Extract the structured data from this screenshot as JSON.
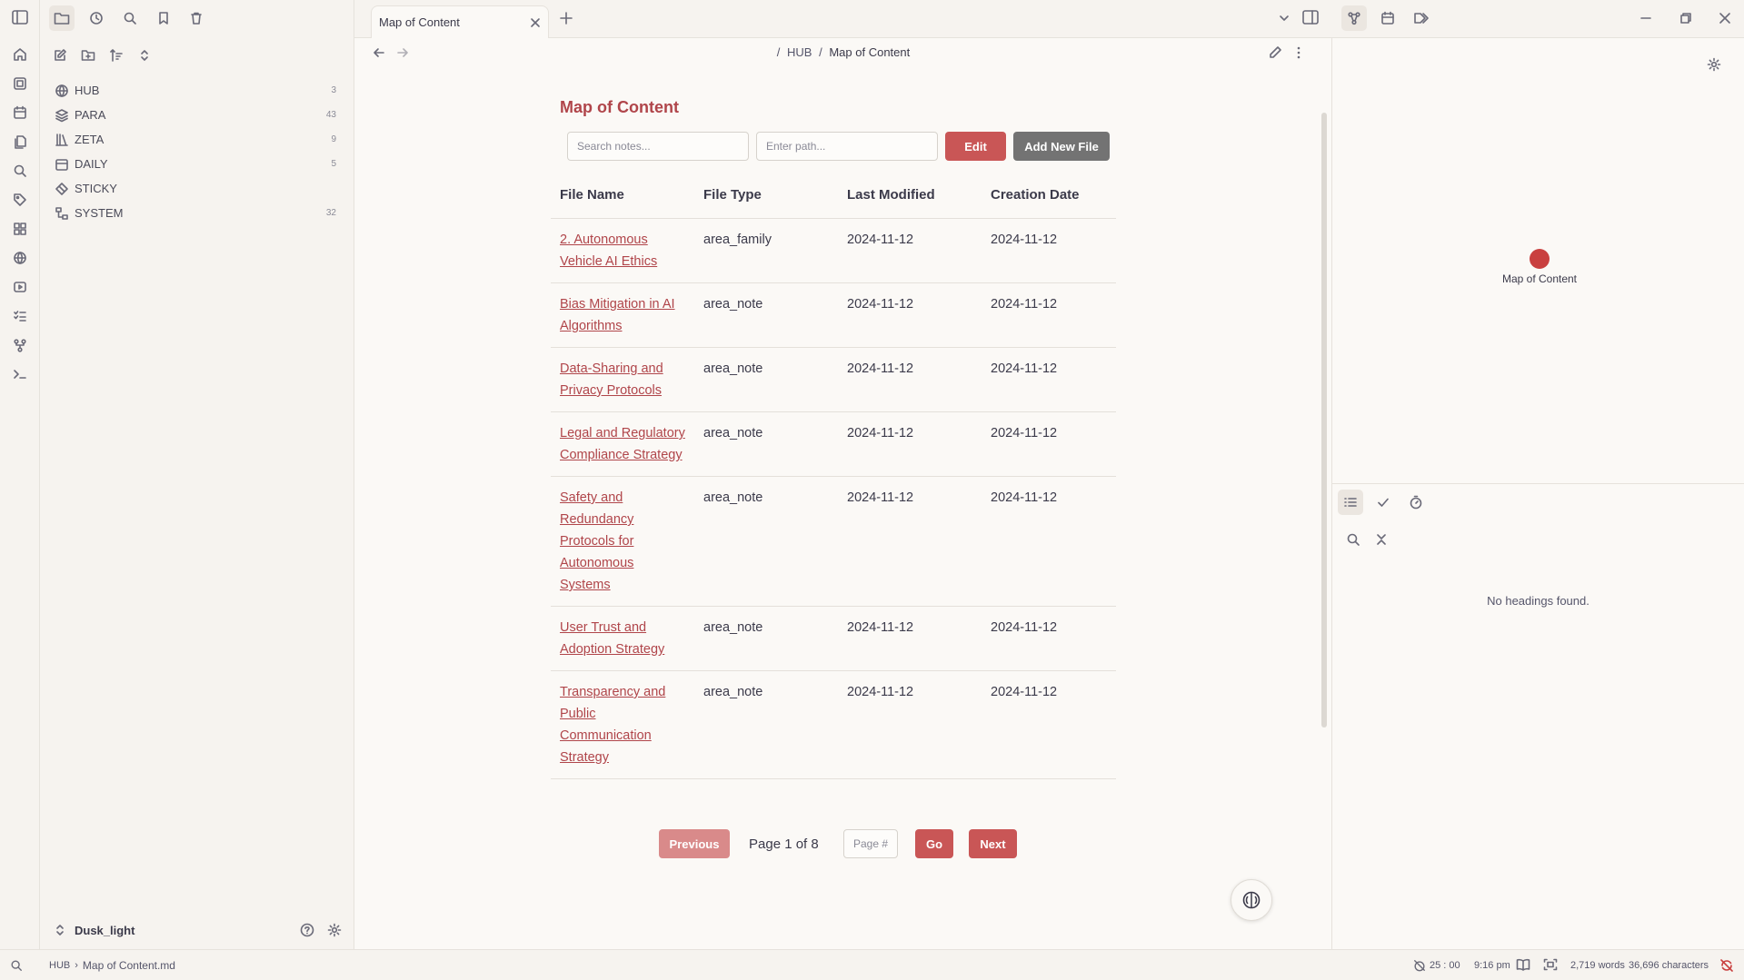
{
  "ribbon": {
    "icons": [
      "home-icon",
      "pages-icon",
      "calendar-icon",
      "file-copy-icon",
      "search-icon",
      "tag-icon",
      "grid-icon",
      "globe-icon",
      "video-icon",
      "checklist-icon",
      "git-icon",
      "terminal-icon"
    ]
  },
  "sidebar": {
    "top_icons": [
      "sidebar-toggle-icon",
      "folder-icon",
      "clock-icon",
      "search-icon",
      "bookmark-icon",
      "trash-icon"
    ],
    "actions": [
      "new-note-icon",
      "new-folder-icon",
      "sort-icon",
      "collapse-icon"
    ],
    "items": [
      {
        "label": "HUB",
        "count": "3"
      },
      {
        "label": "PARA",
        "count": "43"
      },
      {
        "label": "ZETA",
        "count": "9"
      },
      {
        "label": "DAILY",
        "count": "5"
      },
      {
        "label": "STICKY",
        "count": ""
      },
      {
        "label": "SYSTEM",
        "count": "32"
      }
    ],
    "vault_name": "Dusk_light"
  },
  "tabbar": {
    "tab_title": "Map of Content",
    "new_tab": "+"
  },
  "main": {
    "breadcrumb_sep": "/",
    "breadcrumb_folder": "HUB",
    "breadcrumb_file": "Map of Content",
    "title": "Map of Content",
    "search_placeholder": "Search notes...",
    "path_placeholder": "Enter path...",
    "edit_label": "Edit",
    "add_label": "Add New File",
    "columns": [
      "File Name",
      "File Type",
      "Last Modified",
      "Creation Date"
    ],
    "rows": [
      {
        "name": "2. Autonomous Vehicle AI Ethics",
        "type": "area_family",
        "modified": "2024-11-12",
        "created": "2024-11-12"
      },
      {
        "name": "Bias Mitigation in AI Algorithms",
        "type": "area_note",
        "modified": "2024-11-12",
        "created": "2024-11-12"
      },
      {
        "name": "Data-Sharing and Privacy Protocols",
        "type": "area_note",
        "modified": "2024-11-12",
        "created": "2024-11-12"
      },
      {
        "name": "Legal and Regulatory Compliance Strategy",
        "type": "area_note",
        "modified": "2024-11-12",
        "created": "2024-11-12"
      },
      {
        "name": "Safety and Redundancy Protocols for Autonomous Systems",
        "type": "area_note",
        "modified": "2024-11-12",
        "created": "2024-11-12"
      },
      {
        "name": "User Trust and Adoption Strategy",
        "type": "area_note",
        "modified": "2024-11-12",
        "created": "2024-11-12"
      },
      {
        "name": "Transparency and Public Communication Strategy",
        "type": "area_note",
        "modified": "2024-11-12",
        "created": "2024-11-12"
      }
    ],
    "prev_label": "Previous",
    "page_info": "Page 1 of 8",
    "page_placeholder": "Page #",
    "go_label": "Go",
    "next_label": "Next"
  },
  "right": {
    "graph_node_label": "Map of Content",
    "no_headings": "No headings found."
  },
  "status": {
    "path_folder": "HUB",
    "path_file": "Map of Content.md",
    "timer": "25 : 00",
    "time": "9:16 pm",
    "words": "2,719 words",
    "chars": "36,696 characters"
  },
  "colors": {
    "accent": "#b0454a",
    "button_red": "#c95656",
    "button_gray": "#737373",
    "graph_node": "#c9403f"
  }
}
